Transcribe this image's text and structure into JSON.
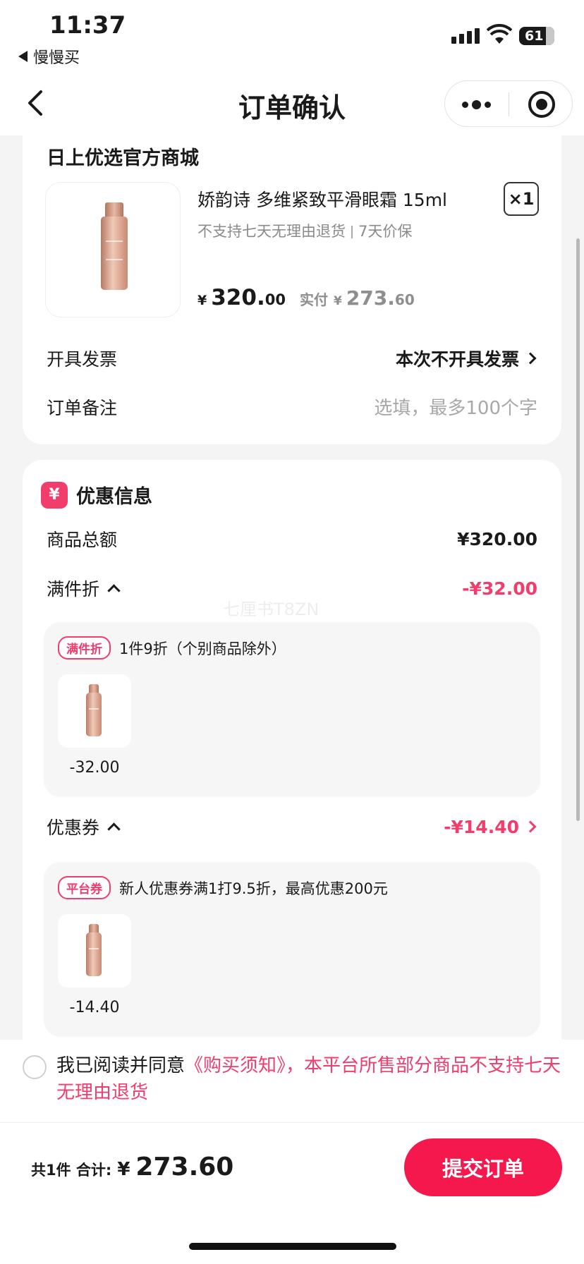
{
  "status": {
    "time": "11:37",
    "back_app": "慢慢买",
    "battery": "61"
  },
  "nav": {
    "title": "订单确认"
  },
  "shop": {
    "name": "日上优选官方商城"
  },
  "product": {
    "name": "娇韵诗 多维紧致平滑眼霜 15ml",
    "tag1": "不支持七天无理由退货",
    "tag2": "7天价保",
    "qty": "×1",
    "price_currency": "¥",
    "price_int": "320.",
    "price_dec": "00",
    "paid_label": "实付",
    "paid_currency": "¥",
    "paid_int": "273.",
    "paid_dec": "60"
  },
  "invoice": {
    "label": "开具发票",
    "value": "本次不开具发票"
  },
  "remark": {
    "label": "订单备注",
    "placeholder": "选填，最多100个字"
  },
  "promo": {
    "title": "优惠信息",
    "icon": "¥",
    "total_label": "商品总额",
    "total_value": "¥320.00",
    "discount_label": "满件折",
    "discount_value": "-¥32.00",
    "discount_tag": "满件折",
    "discount_desc": "1件9折（个别商品除外）",
    "discount_item_amount": "-32.00",
    "coupon_label": "优惠券",
    "coupon_value": "-¥14.40",
    "coupon_tag": "平台券",
    "coupon_desc": "新人优惠券满1打9.5折，最高优惠200元",
    "coupon_item_amount": "-14.40"
  },
  "watermark": "七厘书T8ZN",
  "agreement": {
    "prefix": "我已阅读并同意",
    "link": "《购买须知》，本平台所售部分商品不支持七天无理由退货"
  },
  "footer": {
    "count_label": "共1件 合计:",
    "currency": "¥",
    "total": "273.60",
    "submit_label": "提交订单"
  },
  "colors": {
    "accent": "#f23c6c",
    "submit": "#f4184c"
  },
  "icons": [
    "back-arrow-icon",
    "more-dots-icon",
    "close-target-icon",
    "yen-icon",
    "chevron-right-icon",
    "chevron-up-icon",
    "radio-icon"
  ]
}
